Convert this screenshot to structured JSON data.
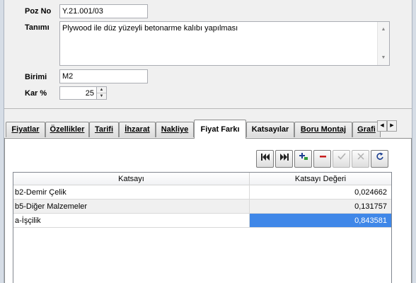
{
  "form": {
    "poz_no_label": "Poz No",
    "poz_no_value": "Y.21.001/03",
    "tanimi_label": "Tanımı",
    "tanimi_value": "Plywood ile düz yüzeyli betonarme kalıbı yapılması",
    "birimi_label": "Birimi",
    "birimi_value": "M2",
    "kar_label": "Kar %",
    "kar_value": "25"
  },
  "tabs": [
    {
      "label": "Fiyatlar"
    },
    {
      "label": "Özellikler"
    },
    {
      "label": "Tarifi"
    },
    {
      "label": "İhzarat"
    },
    {
      "label": "Nakliye"
    },
    {
      "label": "Fiyat Farkı"
    },
    {
      "label": "Katsayılar"
    },
    {
      "label": "Boru Montaj"
    },
    {
      "label": "Grafi"
    }
  ],
  "active_tab": "Fiyat Farkı",
  "grid": {
    "headers": [
      "Katsayı",
      "Katsayı Değeri"
    ],
    "rows": [
      {
        "name": "b2-Demir Çelik",
        "value": "0,024662"
      },
      {
        "name": "b5-Diğer Malzemeler",
        "value": "0,131757"
      },
      {
        "name": "a-İşçilik",
        "value": "0,843581"
      }
    ],
    "selected_row": 2
  },
  "navigator": {
    "buttons": [
      "first-icon",
      "last-icon",
      "insert-icon",
      "delete-icon",
      "post-icon",
      "cancel-icon",
      "refresh-icon"
    ]
  },
  "colors": {
    "selection": "#3f87e8",
    "background": "#f0f0f0"
  }
}
